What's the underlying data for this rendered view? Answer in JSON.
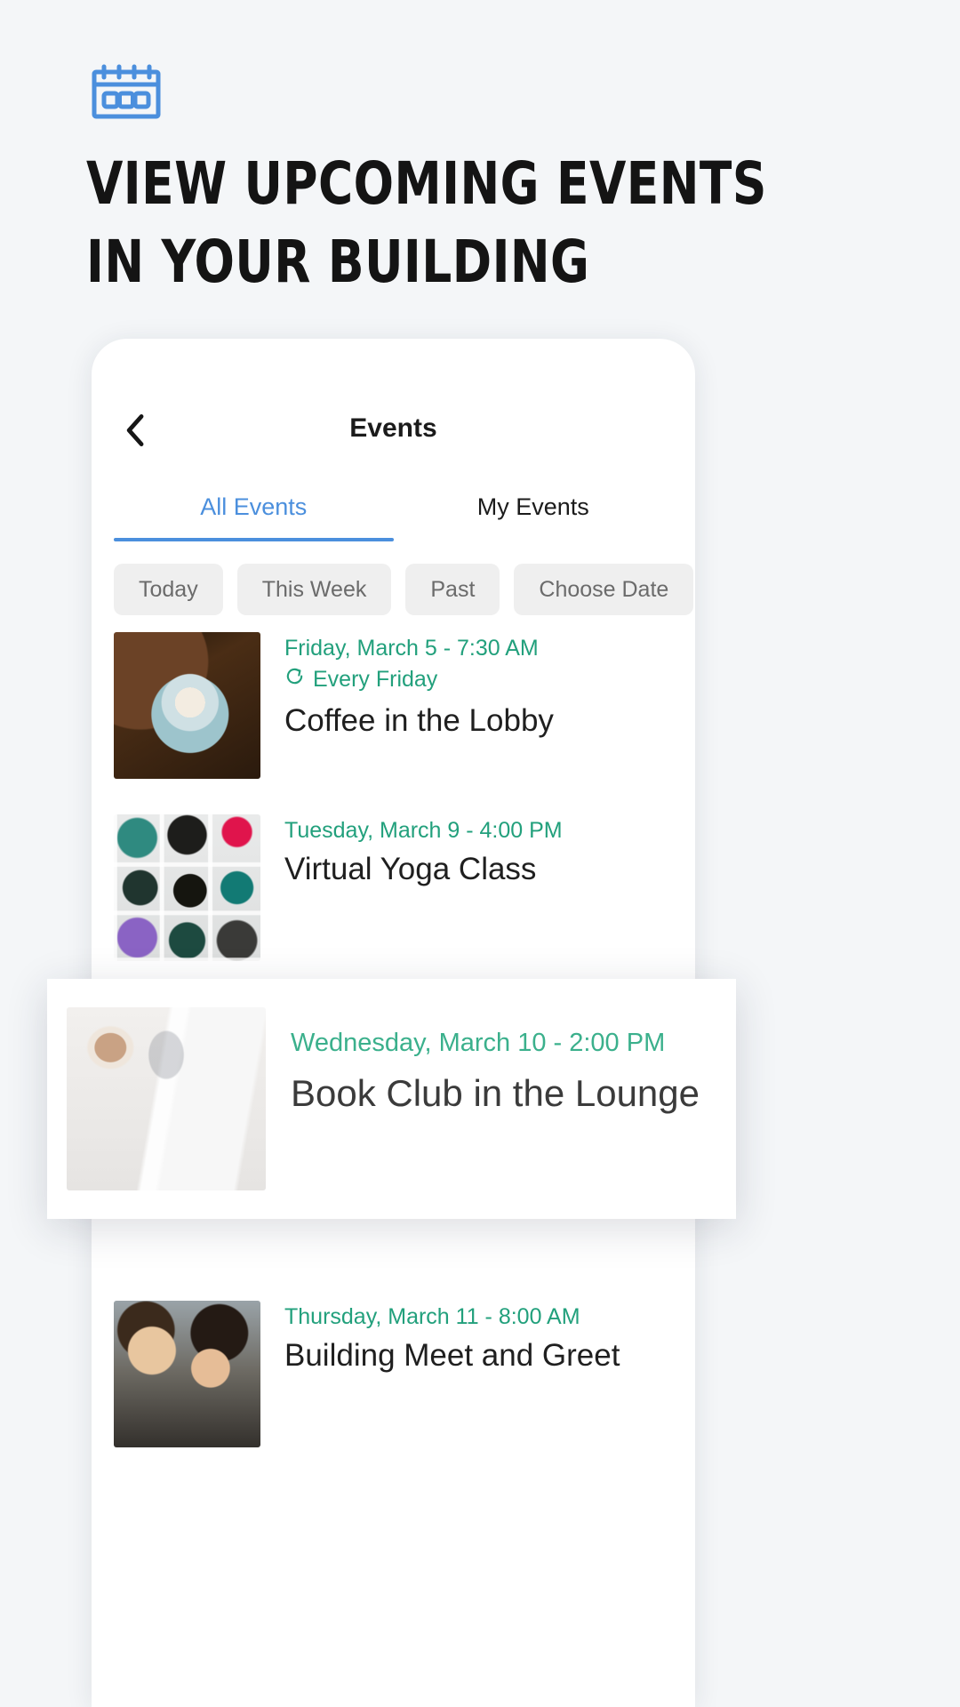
{
  "promo": {
    "icon": "calendar-icon",
    "icon_color": "#4b8fdd",
    "headline": "VIEW UPCOMING EVENTS\nIN YOUR BUILDING"
  },
  "phone": {
    "navbar": {
      "back_icon": "chevron-left-icon",
      "title": "Events"
    },
    "tabs": [
      {
        "label": "All Events",
        "active": true
      },
      {
        "label": "My Events",
        "active": false
      }
    ],
    "filters": [
      {
        "label": "Today"
      },
      {
        "label": "This Week"
      },
      {
        "label": "Past"
      },
      {
        "label": "Choose Date"
      }
    ],
    "events": [
      {
        "date": "Friday, March 5 - 7:30 AM",
        "repeat": "Every Friday",
        "repeat_icon": "repeat-icon",
        "title": "Coffee in the Lobby",
        "photo": "coffee-cup-photo"
      },
      {
        "date": "Tuesday, March 9 - 4:00 PM",
        "repeat": "",
        "title": "Virtual Yoga Class",
        "photo": "yoga-mats-photo"
      },
      {
        "date": "Thursday, March 11 - 8:00 AM",
        "repeat": "",
        "title": "Building Meet and Greet",
        "photo": "people-smiling-photo"
      }
    ],
    "highlight_event": {
      "date": "Wednesday, March 10 - 2:00 PM",
      "title": "Book Club in the Lounge",
      "photo": "open-book-coffee-photo"
    }
  },
  "colors": {
    "page_background": "#f4f6f8",
    "accent_blue": "#4b8fdd",
    "accent_green": "#22a07c",
    "highlight_green": "#3bb08c",
    "chip_background": "#efefef",
    "chip_text": "#6b6b6b",
    "title_text": "#1f1f1f",
    "headline_text": "#141414"
  }
}
